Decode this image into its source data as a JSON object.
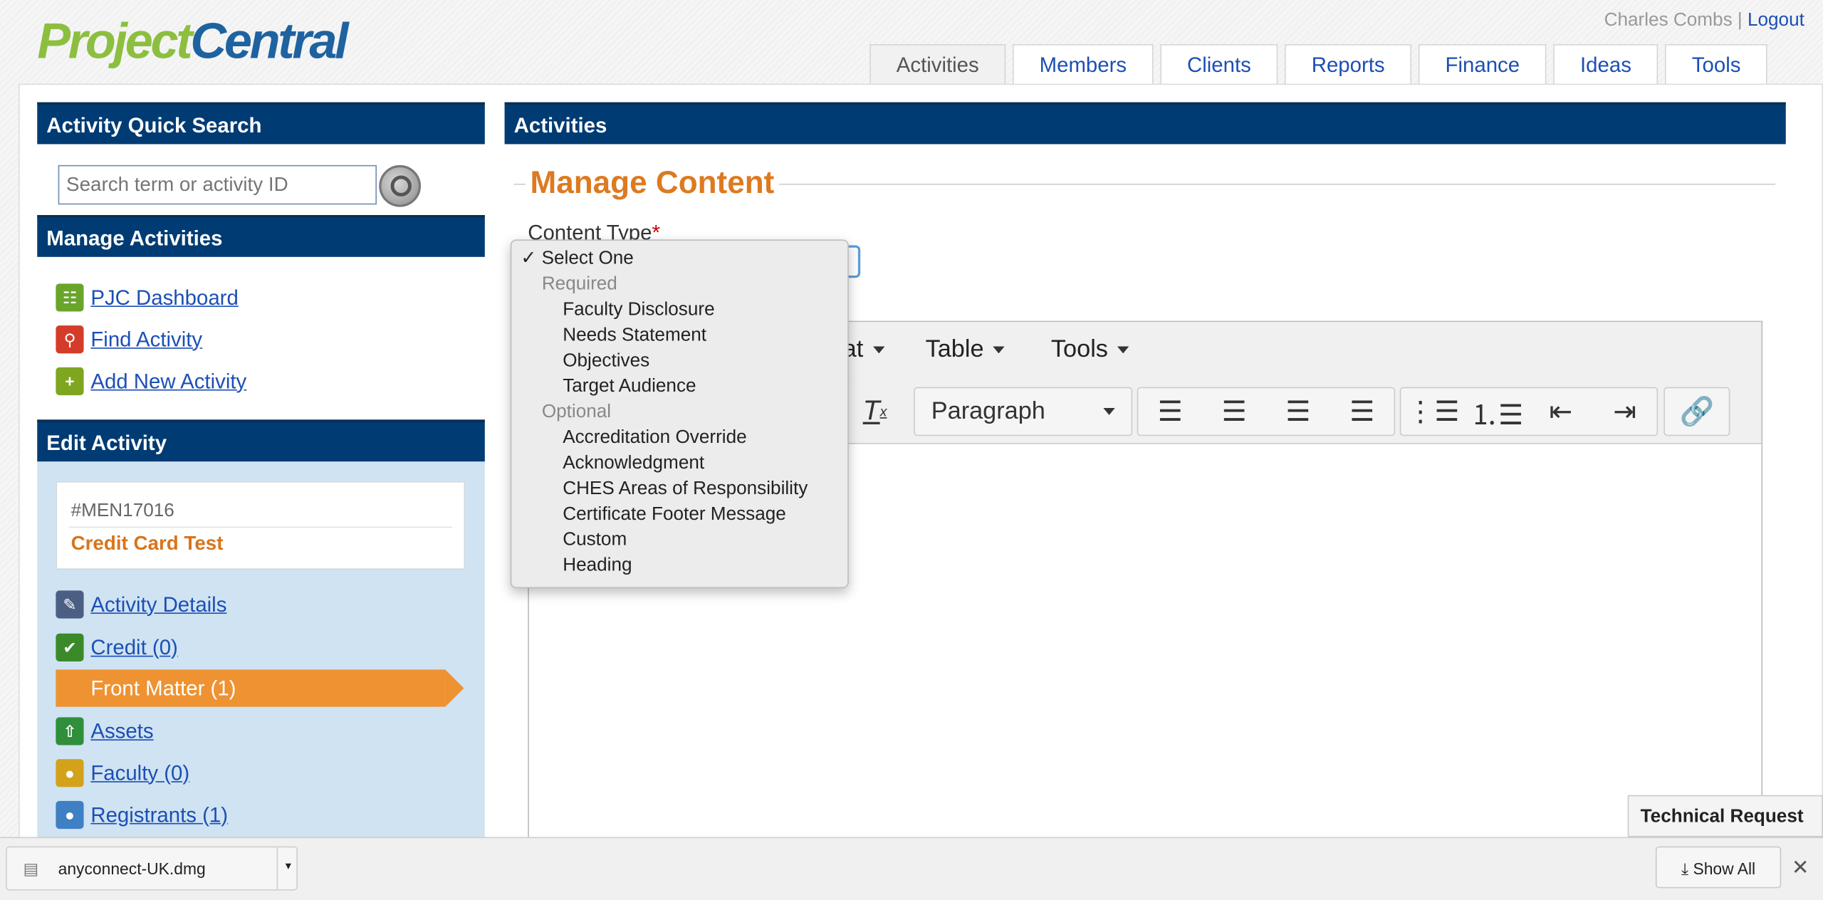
{
  "header": {
    "logo_part1": "Project",
    "logo_part2": "Central",
    "user": "Charles Combs",
    "separator": "|",
    "logout": "Logout"
  },
  "tabs": [
    "Activities",
    "Members",
    "Clients",
    "Reports",
    "Finance",
    "Ideas",
    "Tools"
  ],
  "sidebar": {
    "quick_search": {
      "title": "Activity Quick Search",
      "placeholder": "Search term or activity ID"
    },
    "manage": {
      "title": "Manage Activities",
      "items": [
        "PJC Dashboard",
        "Find Activity",
        "Add New Activity"
      ]
    },
    "edit": {
      "title": "Edit Activity",
      "activity_id": "#MEN17016",
      "activity_name": "Credit Card Test",
      "items": [
        "Activity Details",
        "Credit (0)",
        "Front Matter (1)",
        "Assets",
        "Faculty (0)",
        "Registrants (1)"
      ]
    }
  },
  "main": {
    "title": "Activities",
    "section": "Manage Content",
    "content_type_label": "Content Type",
    "required_mark": "*",
    "editor_menus": [
      "at",
      "Table",
      "Tools"
    ],
    "paragraph": "Paragraph"
  },
  "dropdown": {
    "selected": "Select One",
    "check": "✓",
    "groups": [
      {
        "label": "Required",
        "options": [
          "Faculty Disclosure",
          "Needs Statement",
          "Objectives",
          "Target Audience"
        ]
      },
      {
        "label": "Optional",
        "options": [
          "Accreditation Override",
          "Acknowledgment",
          "CHES Areas of Responsibility",
          "Certificate Footer Message",
          "Custom",
          "Heading"
        ]
      }
    ]
  },
  "tech_request": "Technical Request",
  "download": {
    "filename": "anyconnect-UK.dmg",
    "show_all": "Show All"
  },
  "colors": {
    "brand_blue": "#003b73",
    "accent_orange": "#ee9232",
    "link": "#1c4fb5",
    "logo_green": "#8cbf3f"
  }
}
